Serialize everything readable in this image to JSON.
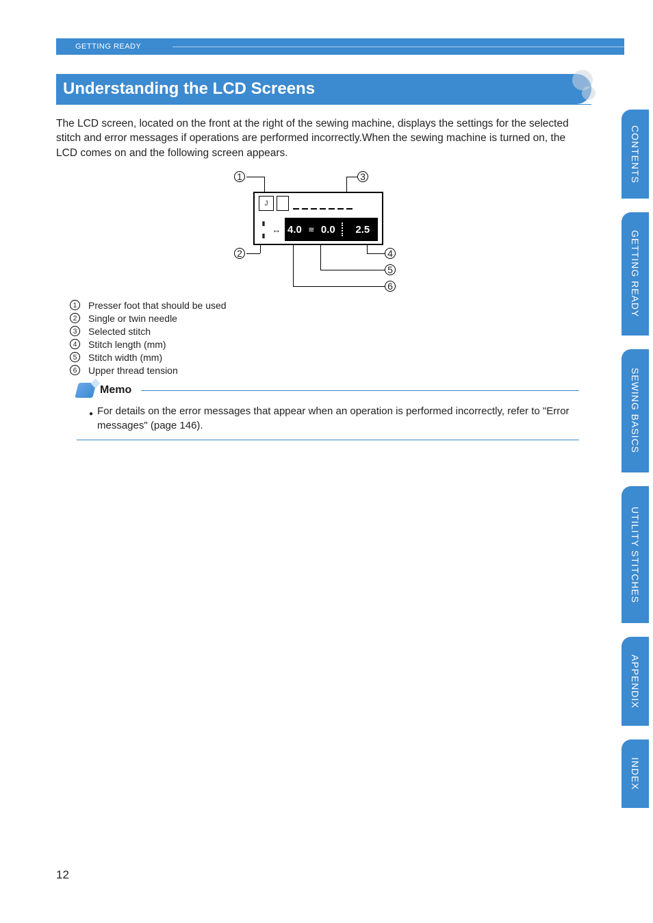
{
  "running_header": "GETTING READY",
  "section_title": "Understanding the LCD Screens",
  "intro_text": "The LCD screen, located on the front at the right of the sewing machine, displays the settings for the selected stitch and error messages if operations are performed incorrectly.When the sewing machine is turned on, the LCD comes on and the following screen appears.",
  "lcd": {
    "presser_foot_label": "J",
    "value_width": "4.0",
    "value_mid": "0.0",
    "value_length": "2.5"
  },
  "callouts": {
    "c1": "1",
    "c2": "2",
    "c3": "3",
    "c4": "4",
    "c5": "5",
    "c6": "6"
  },
  "legend": [
    {
      "n": "1",
      "text": "Presser foot that should be used"
    },
    {
      "n": "2",
      "text": "Single or twin needle"
    },
    {
      "n": "3",
      "text": "Selected stitch"
    },
    {
      "n": "4",
      "text": "Stitch length (mm)"
    },
    {
      "n": "5",
      "text": "Stitch width (mm)"
    },
    {
      "n": "6",
      "text": "Upper thread tension"
    }
  ],
  "memo": {
    "title": "Memo",
    "item": "For details on the error messages that appear when an operation is performed incorrectly, refer to \"Error messages\" (page 146)."
  },
  "tabs": [
    "CONTENTS",
    "GETTING READY",
    "SEWING BASICS",
    "UTILITY STITCHES",
    "APPENDIX",
    "INDEX"
  ],
  "page_number": "12"
}
